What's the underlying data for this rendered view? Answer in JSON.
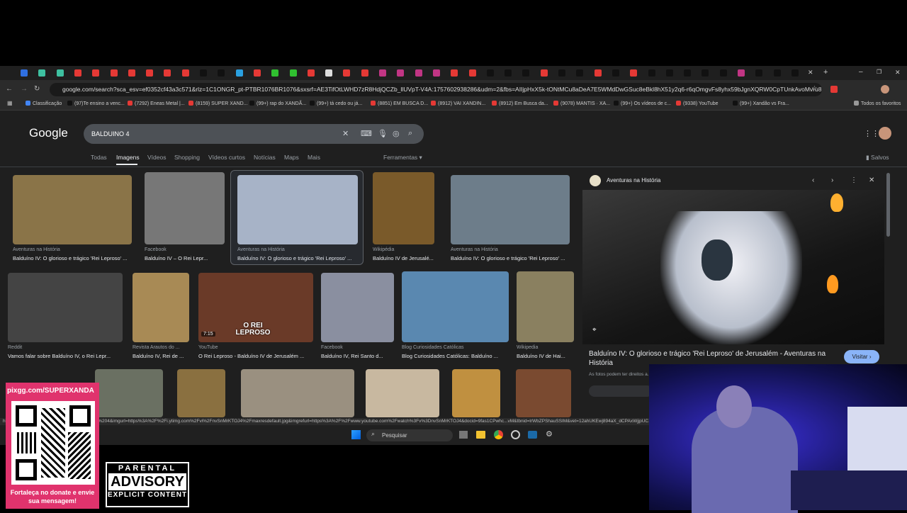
{
  "browser": {
    "url": "google.com/search?sca_esv=ef0352cf43a3c571&rlz=1C1ONGR_pt-PTBR1076BR1076&sxsrf=AE3TifOtLWHD7zR8HdjQCZb_llUVpT-V4A:1757602938286&udm=2&fbs=AIIjpHxX5k-tONtMCu8aDeA7E5WMdDwGSuc8eBkl8hX51y2q6-r6qOmgvFs8yhx59bJgnXQRW0CpTUnkAvoMvru8Q5EkjQ7FupD3cXkpY3rX...",
    "bookmarks": [
      {
        "label": "Classificação",
        "color": "#4285f4"
      },
      {
        "label": "(97)Te ensino a venc...",
        "color": "#111"
      },
      {
        "label": "(7292) Eneas Metal |...",
        "color": "#e53935"
      },
      {
        "label": "(8159) SUPER XAND...",
        "color": "#e53935"
      },
      {
        "label": "(99+) rap do XANDÃ...",
        "color": "#111"
      },
      {
        "label": "(99+) tá cedo ou já...",
        "color": "#111"
      },
      {
        "label": "(8851) EM BUSCA D...",
        "color": "#e53935"
      },
      {
        "label": "(8912) VAI XANDIN...",
        "color": "#e53935"
      },
      {
        "label": "(8912) Em Busca da...",
        "color": "#e53935"
      },
      {
        "label": "(9078) MANTIS · XA...",
        "color": "#e53935"
      },
      {
        "label": "(99+) Os vídeos de c...",
        "color": "#111"
      },
      {
        "label": "(9338) YouTube",
        "color": "#e53935"
      },
      {
        "label": "(99+) Xandão vs Fra...",
        "color": "#111"
      }
    ],
    "all_bookmarks": "Todos os favoritos",
    "status_url": "https://www.google.com/imgres?q=BALDUINO%204&imgurl=https%3A%2F%2Fi.ytimg.com%2Fvi%2FnvSnMrKTOJ4%2Fmaxresdefault.jpg&imgrefurl=https%3A%2F%2Fwww.youtube.com%2Fwatch%3Fv%3DnvSnMrKTOJ4&docid=9fas1CPwhc...vM&tbnid=lrWbZPShauSSIM&vet=12ahUKEwj894aX_dCPAxWjjpUC..."
  },
  "google": {
    "logo": "Google",
    "query": "BALDUINO 4",
    "tabs": [
      "Todas",
      "Imagens",
      "Vídeos",
      "Shopping",
      "Vídeos curtos",
      "Notícias",
      "Maps",
      "Mais"
    ],
    "active_tab": "Imagens",
    "tools": "Ferramentas",
    "saved": "Salvos"
  },
  "results_row1": [
    {
      "source": "Aventuras na História",
      "caption": "Balduíno IV: O glorioso e trágico 'Rei Leproso' ...",
      "color": "#8a7448"
    },
    {
      "source": "Facebook",
      "caption": "Balduíno IV – O Rei Lepr...",
      "color": "#777"
    },
    {
      "source": "Aventuras na História",
      "caption": "Balduíno IV: O glorioso e trágico 'Rei Leproso' ...",
      "color": "#aab4c4"
    },
    {
      "source": "Wikipédia",
      "caption": "Balduíno IV de Jerusalé...",
      "color": "#7a5a2a"
    },
    {
      "source": "Aventuras na História",
      "caption": "Balduíno IV: O glorioso e trágico 'Rei Leproso' ...",
      "color": "#6d7d8a"
    }
  ],
  "results_row2": [
    {
      "source": "Reddit",
      "caption": "Vamos falar sobre Balduíno IV, o Rei Lepr...",
      "color": "#444"
    },
    {
      "source": "Revista Arautos do ...",
      "caption": "Balduíno IV, Rei de ...",
      "color": "#a88a55"
    },
    {
      "source": "YouTube",
      "caption": "O Rei Leproso - Balduíno IV de Jerusalém ...",
      "color": "#6a3a28"
    },
    {
      "source": "Facebook",
      "caption": "Balduíno IV, Rei Santo d...",
      "color": "#8a8fa0"
    },
    {
      "source": "Blog Curiosidades Católicas",
      "caption": "Blog Curiosidades Católicas: Balduíno ...",
      "color": "#5a88b0"
    },
    {
      "source": "Wikipedia",
      "caption": "Balduíno IV de Hai...",
      "color": "#8a8060"
    }
  ],
  "video_thumb": {
    "duration": "7:15",
    "overlay": "O REI LEPROSO"
  },
  "panel": {
    "source": "Aventuras na História",
    "title": "Balduíno IV: O glorioso e trágico 'Rei Leproso' de Jerusalém - Aventuras na História",
    "visit": "Visitar",
    "note": "As fotos podem ter direitos a..."
  },
  "taskbar": {
    "search_placeholder": "Pesquisar"
  },
  "overlay": {
    "donate_url": "pixgg.com/SUPERXANDA",
    "donate_msg": "Fortaleça no donate e envie sua mensagem!",
    "advisory_top": "PARENTAL",
    "advisory_mid": "ADVISORY",
    "advisory_bottom": "EXPLICIT CONTENT"
  },
  "colors": {
    "accent": "#8ab4f8",
    "donate_bg": "#e0336d",
    "page_bg": "#1f1f1f"
  }
}
